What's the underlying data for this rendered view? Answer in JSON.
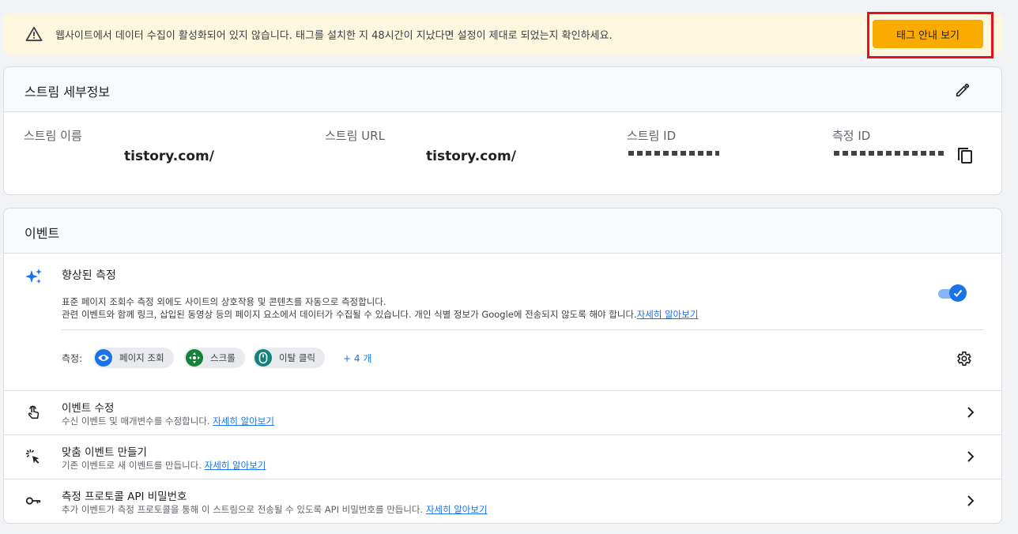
{
  "banner": {
    "message": "웹사이트에서 데이터 수집이 활성화되어 있지 않습니다. 태그를 설치한 지 48시간이 지났다면 설정이 제대로 되었는지 확인하세요.",
    "button_label": "태그 안내 보기",
    "icon": "warning-icon"
  },
  "stream_details": {
    "title": "스트림 세부정보",
    "fields": [
      {
        "label": "스트림 이름",
        "value": "tistory.com/"
      },
      {
        "label": "스트림 URL",
        "value": "tistory.com/"
      },
      {
        "label": "스트림 ID",
        "value": ""
      },
      {
        "label": "측정 ID",
        "value": ""
      }
    ]
  },
  "events": {
    "title": "이벤트",
    "enhanced": {
      "title": "향상된 측정",
      "desc_line1": "표준 페이지 조회수 측정 외에도 사이트의 상호작용 및 콘텐츠를 자동으로 측정합니다.",
      "desc_line2": "관련 이벤트와 함께 링크, 삽입된 동영상 등의 페이지 요소에서 데이터가 수집될 수 있습니다. 개인 식별 정보가 Google에 전송되지 않도록 해야 합니다.",
      "learn_more": "자세히 알아보기",
      "enabled": true,
      "measure_label": "측정:",
      "chips": [
        {
          "label": "페이지 조회",
          "icon": "eye-icon",
          "color": "#1a73e8"
        },
        {
          "label": "스크롤",
          "icon": "crosshair-icon",
          "color": "#188038"
        },
        {
          "label": "이탈 클릭",
          "icon": "mouse-icon",
          "color": "#12827a"
        }
      ],
      "more": "+ 4 개"
    },
    "rows": [
      {
        "title": "이벤트 수정",
        "desc": "수신 이벤트 및 매개변수를 수정합니다.",
        "link": "자세히 알아보기",
        "icon": "touch-icon"
      },
      {
        "title": "맞춤 이벤트 만들기",
        "desc": "기존 이벤트로 새 이벤트를 만듭니다.",
        "link": "자세히 알아보기",
        "icon": "click-sparkle-icon"
      },
      {
        "title": "측정 프로토콜 API 비밀번호",
        "desc": "추가 이벤트가 측정 프로토콜을 통해 이 스트림으로 전송될 수 있도록 API 비밀번호를 만듭니다.",
        "link": "자세히 알아보기",
        "icon": "key-icon"
      }
    ]
  },
  "colors": {
    "accent": "#1a73e8",
    "banner_bg": "#fef7e0",
    "button_bg": "#f9ab00",
    "highlight": "#e8101b"
  }
}
